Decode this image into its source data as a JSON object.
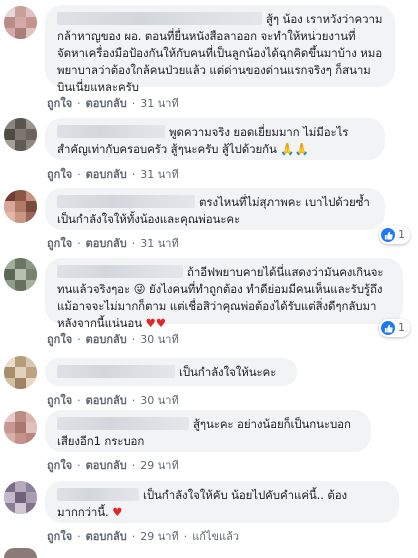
{
  "comments": [
    {
      "text": "สู้ๆ น้อง เราหวังว่าความกล้าหาญของ ผอ. ตอนที่ยื่นหนังสือลาออก จะทำให้หน่วยงานที่จัดหาเครื่องมือป้องกันให้กับคนที่เป็นลูกน้องได้ฉุกคิดขึ้นมาบ้าง หมอพยาบาลว่าต้องใกล้คนป่วยแล้ว แต่ด่านของด่านแรกจริงๆ ก็สนามบินเนี่ยแหละครับ",
      "like": "ถูกใจ",
      "reply": "ตอบกลับ",
      "time": "31 นาที",
      "reaction_count": ""
    },
    {
      "text": "พูดความจริง ยอดเยี่ยมมาก ไม่มีอะไรสำคัญเท่ากับครอบครัว สู้ๆนะครับ สู้ไปด้วยกัน 🙏🙏",
      "like": "ถูกใจ",
      "reply": "ตอบกลับ",
      "time": "31 นาที",
      "reaction_count": ""
    },
    {
      "text": "ตรงไหนที่ไม่สุภาพคะ เบาไปด้วยซ้ำ เป็นกำลังใจให้ทั้งน้องและคุณพ่อนะคะ",
      "like": "ถูกใจ",
      "reply": "ตอบกลับ",
      "time": "31 นาที",
      "reaction_count": "1"
    },
    {
      "text": "ถ้าอีฟพยาบคายได้นี่แสดงว่ามันคงเกินจะทนแล้วจริงๆอะ 😜 ยังไงคนที่ทำถูกต้อง ทำดีย่อมมีคนเห็นและรับรู้ถึงแม้อาจจะไม่มากก็ตาม แต่เชื่อสิว่าคุณพ่อต้องได้รับแต่สิ่งดีๆกลับมาหลังจากนี้แน่นอน",
      "hearts": "♥♥",
      "like": "ถูกใจ",
      "reply": "ตอบกลับ",
      "time": "30 นาที",
      "reaction_count": "1"
    },
    {
      "text": "เป็นกำลังใจให้นะคะ",
      "like": "ถูกใจ",
      "reply": "ตอบกลับ",
      "time": "30 นาที",
      "reaction_count": ""
    },
    {
      "text": "สู้ๆนะคะ อย่างน้อยก็เป็นกนะบอกเสียงอีก1 กระบอก",
      "like": "ถูกใจ",
      "reply": "ตอบกลับ",
      "time": "29 นาที",
      "reaction_count": ""
    },
    {
      "text": "เป็นกำลังใจให้คับ น้อยไปคับคำแค่นี้.. ต้องมากกว่านี้.",
      "hearts": "♥",
      "like": "ถูกใจ",
      "reply": "ตอบกลับ",
      "time": "29 นาที",
      "edited": "แก้ไขแล้ว",
      "reaction_count": ""
    }
  ],
  "colors": {
    "bubble": "#f2f3f5",
    "meta_text": "#606770",
    "like_blue": "#2078f4",
    "heart_red": "#e02828"
  },
  "icons": {
    "reaction": "like-thumb-icon",
    "heart": "heart-emoji"
  }
}
